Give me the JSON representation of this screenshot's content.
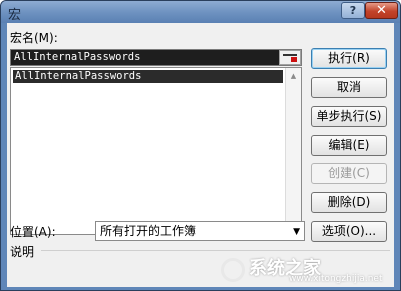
{
  "window": {
    "title": "宏",
    "help_label": "?",
    "close_label": "✕"
  },
  "macro_name": {
    "label": "宏名(M):",
    "value": "AllInternalPasswords"
  },
  "macro_list": {
    "items": [
      "AllInternalPasswords"
    ]
  },
  "buttons": {
    "run": "执行(R)",
    "cancel": "取消",
    "step_into": "单步执行(S)",
    "edit": "编辑(E)",
    "create": "创建(C)",
    "delete": "删除(D)",
    "options": "选项(O)..."
  },
  "location": {
    "label": "位置(A):",
    "value": "所有打开的工作簿"
  },
  "description": {
    "label": "说明"
  },
  "watermark": {
    "text": "系统之家",
    "url": "www.xitongzhijia.net"
  },
  "icons": {
    "picker": "collapse-dialog-icon",
    "dropdown": "chevron-down-icon",
    "scroll_up": "scroll-up-icon",
    "scroll_down": "scroll-down-icon"
  },
  "colors": {
    "titlebar": "#5f86b8",
    "close_button": "#c2432a",
    "selection": "#2b2b2b",
    "client": "#f0f0f0"
  }
}
